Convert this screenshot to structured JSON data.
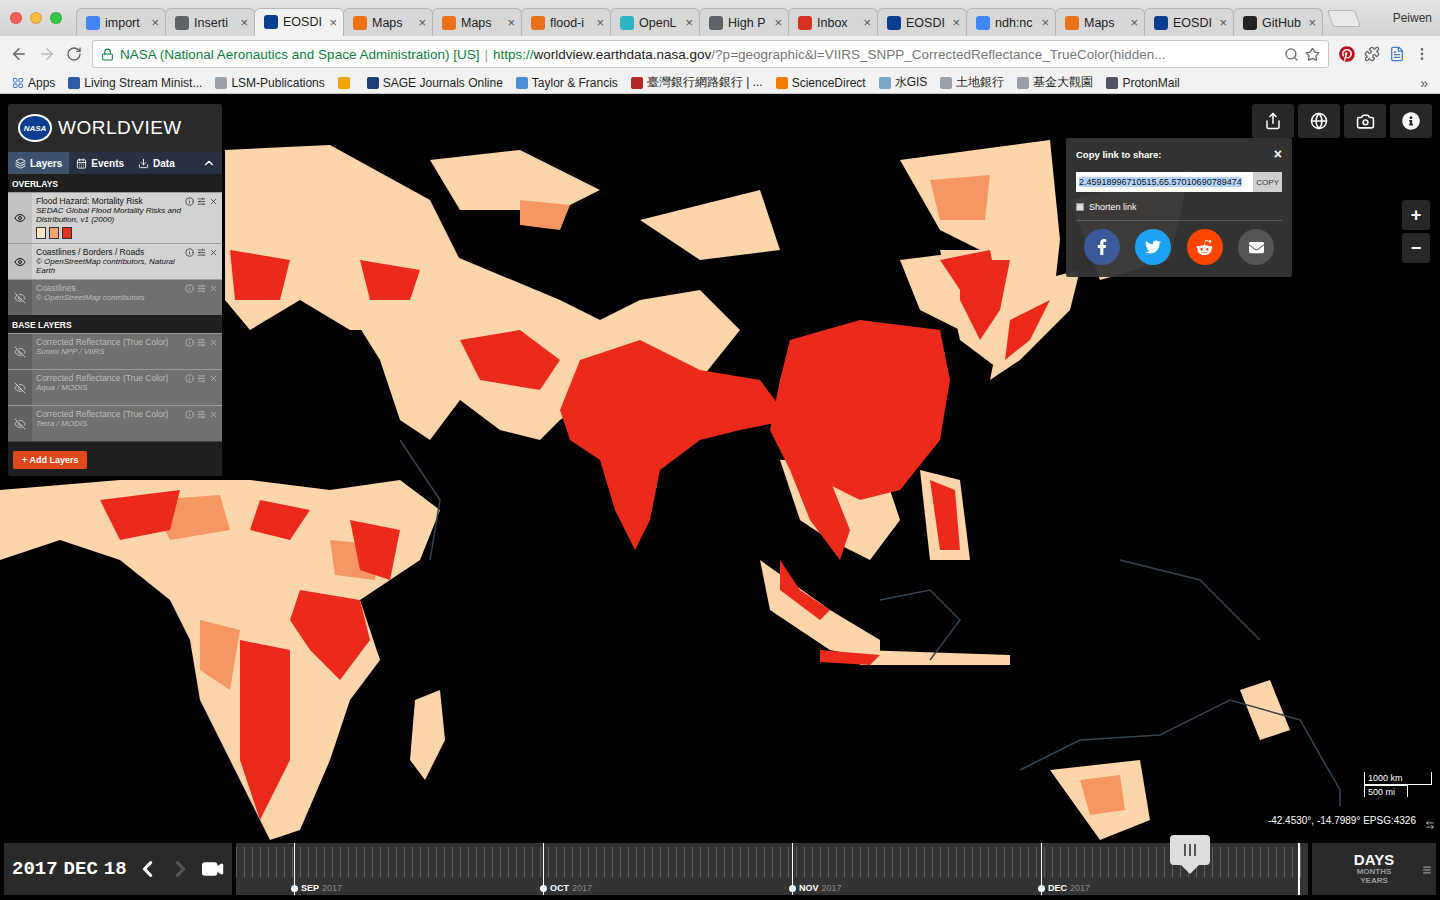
{
  "browser": {
    "tabs": [
      {
        "label": "import",
        "selected": false,
        "color": "#4285f4"
      },
      {
        "label": "Inserti",
        "selected": false,
        "color": "#5f6368"
      },
      {
        "label": "EOSDI",
        "selected": true,
        "color": "#0b3d91"
      },
      {
        "label": "Maps",
        "selected": false,
        "color": "#e8711a"
      },
      {
        "label": "Maps",
        "selected": false,
        "color": "#e8711a"
      },
      {
        "label": "flood-i",
        "selected": false,
        "color": "#e8711a"
      },
      {
        "label": "OpenL",
        "selected": false,
        "color": "#2bb5c5"
      },
      {
        "label": "High P",
        "selected": false,
        "color": "#5f6368"
      },
      {
        "label": "Inbox",
        "selected": false,
        "color": "#d93025"
      },
      {
        "label": "EOSDI",
        "selected": false,
        "color": "#0b3d91"
      },
      {
        "label": "ndh:nc",
        "selected": false,
        "color": "#4285f4"
      },
      {
        "label": "Maps",
        "selected": false,
        "color": "#e8711a"
      },
      {
        "label": "EOSDI",
        "selected": false,
        "color": "#0b3d91"
      },
      {
        "label": "GitHub",
        "selected": false,
        "color": "#222222"
      }
    ],
    "close_glyph": "×",
    "profile": "Peiwen",
    "address": {
      "site": "NASA (National Aeronautics and Space Administration) [US]",
      "separator": "|",
      "scheme": "https://",
      "host": "worldview.earthdata.nasa.gov",
      "path": "/?p=geographic&l=VIIRS_SNPP_CorrectedReflectance_TrueColor(hidden..."
    },
    "bookmarks": [
      {
        "label": "Apps",
        "color": "#4a7bd0"
      },
      {
        "label": "Living Stream Minist...",
        "color": "#2a5aa8"
      },
      {
        "label": "LSM-Publications",
        "color": "#9aa0a6"
      },
      {
        "label": "",
        "color": "#f0a500"
      },
      {
        "label": "SAGE Journals Online",
        "color": "#1d3c78"
      },
      {
        "label": "Taylor & Francis",
        "color": "#4a90d9"
      },
      {
        "label": "臺灣銀行網路銀行 | ...",
        "color": "#b02a2a"
      },
      {
        "label": "ScienceDirect",
        "color": "#f07d00"
      },
      {
        "label": "水GIS",
        "color": "#7aa6c8"
      },
      {
        "label": "土地銀行",
        "color": "#9aa0a6"
      },
      {
        "label": "基金大觀園",
        "color": "#9aa0a6"
      },
      {
        "label": "ProtonMail",
        "color": "#505264"
      }
    ],
    "bookmarks_more": "»"
  },
  "worldview": {
    "logo": {
      "badge": "NASA",
      "title": "WORLDVIEW"
    },
    "tabs": [
      {
        "label": "Layers",
        "selected": true
      },
      {
        "label": "Events",
        "selected": false
      },
      {
        "label": "Data",
        "selected": false
      }
    ],
    "sections": [
      {
        "title": "OVERLAYS",
        "layers": [
          {
            "name": "Flood Hazard: Mortality Risk",
            "source": "SEDAC Global Flood Mortality Risks and Distribution, v1 (2000)",
            "visible": true,
            "legend": [
              "#fde3c8",
              "#f7a46c",
              "#e8301e"
            ]
          },
          {
            "name": "Coastlines / Borders / Roads",
            "source": "© OpenStreetMap contributors, Natural Earth",
            "visible": true,
            "legend": []
          },
          {
            "name": "Coastlines",
            "source": "© OpenStreetMap contributors",
            "visible": false,
            "legend": []
          }
        ]
      },
      {
        "title": "BASE LAYERS",
        "layers": [
          {
            "name": "Corrected Reflectance (True Color)",
            "source": "Suomi NPP / VIIRS",
            "visible": false,
            "legend": []
          },
          {
            "name": "Corrected Reflectance (True Color)",
            "source": "Aqua / MODIS",
            "visible": false,
            "legend": []
          },
          {
            "name": "Corrected Reflectance (True Color)",
            "source": "Terra / MODIS",
            "visible": false,
            "legend": []
          }
        ]
      }
    ],
    "add_layers": "+ Add Layers",
    "share": {
      "title": "Copy link to share:",
      "close": "×",
      "link": "2.45918996710515,65.57010690789474",
      "copy": "COPY",
      "shorten": {
        "label": "Shorten link",
        "checked": false
      },
      "targets": [
        {
          "kind": "facebook",
          "color": "#3b5998"
        },
        {
          "kind": "twitter",
          "color": "#1da1f2"
        },
        {
          "kind": "reddit",
          "color": "#ff4500"
        },
        {
          "kind": "email",
          "color": "#555555"
        }
      ]
    },
    "zoom": {
      "in": "+",
      "out": "−"
    },
    "scale": {
      "metric": "1000 km",
      "imperial": "500 mi"
    },
    "coordinates": "-42.4530°, -14.7989° EPSG:4326",
    "date": {
      "year": "2017",
      "month": "DEC",
      "day": "18"
    },
    "timeline": {
      "months": [
        {
          "label": "SEP",
          "year": "2017"
        },
        {
          "label": "OCT",
          "year": "2017"
        },
        {
          "label": "NOV",
          "year": "2017"
        },
        {
          "label": "DEC",
          "year": "2017"
        }
      ],
      "level": 0.89
    },
    "units": [
      {
        "label": "DAYS",
        "selected": true
      },
      {
        "label": "MONTHS",
        "selected": false
      },
      {
        "label": "YEARS",
        "selected": false
      }
    ]
  }
}
